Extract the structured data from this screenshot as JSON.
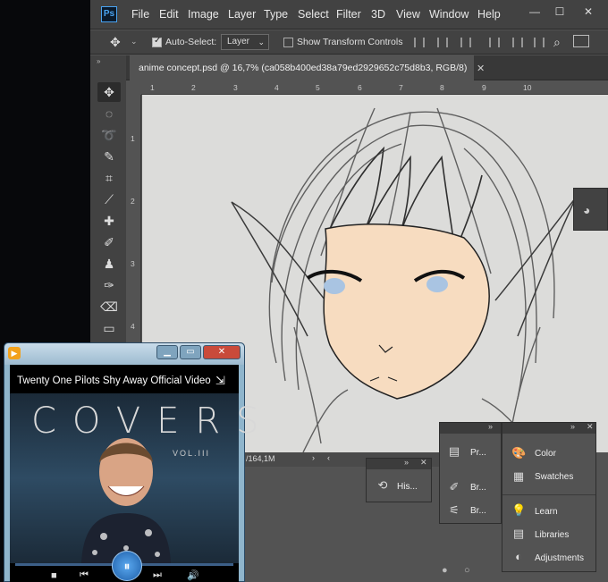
{
  "photoshop": {
    "logo": "Ps",
    "menu": [
      "File",
      "Edit",
      "Image",
      "Layer",
      "Type",
      "Select",
      "Filter",
      "3D",
      "View",
      "Window",
      "Help"
    ],
    "window_controls": [
      "—",
      "☐",
      "✕"
    ],
    "options": {
      "auto_select_label": "Auto-Select:",
      "auto_select_checked": true,
      "layer_value": "Layer",
      "show_transform_label": "Show Transform Controls",
      "show_transform_checked": false
    },
    "document_tab": {
      "title": "anime concept.psd @ 16,7% (ca058b400ed38a79ed2929652c75d8b3, RGB/8)",
      "close": "✕"
    },
    "ruler_top": [
      "1",
      "2",
      "3",
      "4",
      "5",
      "6",
      "7",
      "8",
      "9",
      "10"
    ],
    "ruler_left": [
      "1",
      "2",
      "3",
      "4"
    ],
    "status": "/164,1M",
    "panels": {
      "history": {
        "label": "His..."
      },
      "tools": [
        {
          "label": "Pr...",
          "icon": "properties-icon"
        },
        {
          "label": "Br...",
          "icon": "brush-icon"
        },
        {
          "label": "Br...",
          "icon": "brush-presets-icon"
        }
      ],
      "right": [
        {
          "label": "Color",
          "icon": "palette-icon"
        },
        {
          "label": "Swatches",
          "icon": "grid-icon"
        },
        {
          "label": "Learn",
          "icon": "lightbulb-icon"
        },
        {
          "label": "Libraries",
          "icon": "library-icon"
        },
        {
          "label": "Adjustments",
          "icon": "adjustments-icon"
        }
      ]
    }
  },
  "media_player": {
    "video_title": "Twenty One Pilots  Shy Away Official Video",
    "album_word": "COVERS",
    "album_volume": "VOL.III",
    "window_controls": [
      "▁",
      "▭",
      "✕"
    ],
    "controls": [
      "■",
      "⏮",
      "⏸",
      "⏭",
      "🔊"
    ]
  }
}
